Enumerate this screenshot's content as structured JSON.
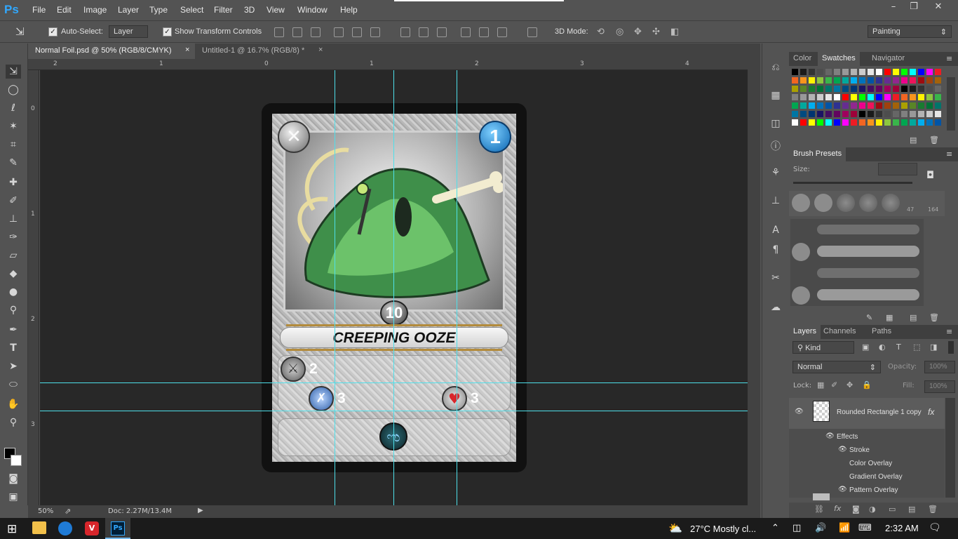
{
  "app": {
    "logo": "Ps",
    "workspace": "Painting"
  },
  "menu": [
    "File",
    "Edit",
    "Image",
    "Layer",
    "Type",
    "Select",
    "Filter",
    "3D",
    "View",
    "Window",
    "Help"
  ],
  "window_controls": {
    "minimize": "–",
    "restore": "❐",
    "close": "✕"
  },
  "options": {
    "auto_select_label": "Auto-Select:",
    "auto_select_target": "Layer",
    "show_transform_label": "Show Transform Controls",
    "mode_3d_label": "3D Mode:"
  },
  "tabs": [
    {
      "label": "Normal Foil.psd @ 50% (RGB/8/CMYK)",
      "close": "×"
    },
    {
      "label": "Untitled-1 @ 16.7% (RGB/8) *",
      "close": "×"
    }
  ],
  "ruler": {
    "top": [
      "2",
      "1",
      "0",
      "1",
      "2",
      "3",
      "4"
    ],
    "left": [
      "0",
      "1",
      "2",
      "3"
    ]
  },
  "card": {
    "mana": "1",
    "health_badge": "10",
    "name": "CREEPING OOZE",
    "stat_attack": "2",
    "stat_speed": "3",
    "stat_health": "3"
  },
  "status": {
    "zoom": "50%",
    "doc": "Doc: 2.27M/13.4M"
  },
  "swatch_tabs": [
    "Color",
    "Swatches",
    "Navigator"
  ],
  "swatch_colors": [
    "#000000",
    "#1a1a1a",
    "#333333",
    "#4d4d4d",
    "#666666",
    "#808080",
    "#999999",
    "#b3b3b3",
    "#cccccc",
    "#e6e6e6",
    "#ffffff",
    "#ff0000",
    "#ffff00",
    "#00ff00",
    "#00ffff",
    "#0000ff",
    "#ff00ff",
    "#ed1c24",
    "#f26522",
    "#f7941d",
    "#fff200",
    "#8dc63f",
    "#39b54a",
    "#00a651",
    "#00a99d",
    "#00aeef",
    "#0072bc",
    "#0054a6",
    "#2e3192",
    "#662d91",
    "#92278f",
    "#ec008c",
    "#ed145b",
    "#9e0b0f",
    "#a0410d",
    "#a3620a",
    "#aba000",
    "#598527",
    "#197b30",
    "#007236",
    "#00746b",
    "#0076a3",
    "#004a80",
    "#003471",
    "#1b1464",
    "#440e62",
    "#630460",
    "#9e005d",
    "#9e0039"
  ],
  "brush": {
    "title": "Brush Presets",
    "size_label": "Size:",
    "sizes": [
      "47",
      "164"
    ]
  },
  "layers": {
    "tabs": [
      "Layers",
      "Channels",
      "Paths"
    ],
    "filter": "Kind",
    "blend": "Normal",
    "opacity_label": "Opacity:",
    "opacity": "100%",
    "lock_label": "Lock:",
    "fill_label": "Fill:",
    "fill": "100%",
    "items": [
      {
        "name": "Rounded Rectangle 1 copy",
        "fx": "fx"
      },
      {
        "name": "Effects"
      },
      {
        "name": "Stroke"
      },
      {
        "name": "Color Overlay"
      },
      {
        "name": "Gradient Overlay"
      },
      {
        "name": "Pattern Overlay"
      }
    ]
  },
  "taskbar": {
    "weather": "27°C  Mostly cl...",
    "time": "2:32 AM"
  },
  "colors": {
    "accent": "#31a8ff",
    "guide": "#4ee0ea",
    "canvas_bg": "#282828",
    "panel_bg": "#535353"
  }
}
